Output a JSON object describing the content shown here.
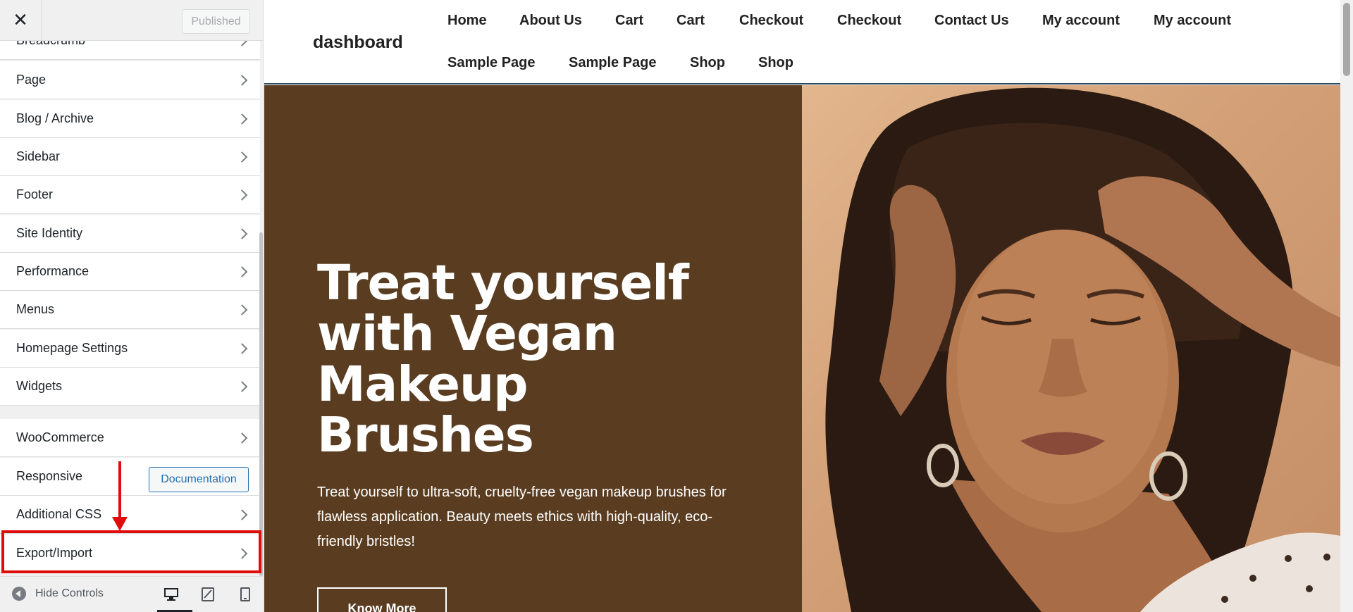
{
  "customizer": {
    "close_icon": "close-icon",
    "publish_label": "Published",
    "panels": [
      {
        "label": "Breadcrumb"
      },
      {
        "label": "Page"
      },
      {
        "label": "Blog / Archive"
      },
      {
        "label": "Sidebar"
      },
      {
        "label": "Footer"
      },
      {
        "label": "Site Identity"
      },
      {
        "label": "Performance"
      },
      {
        "label": "Menus"
      },
      {
        "label": "Homepage Settings"
      },
      {
        "label": "Widgets"
      },
      {
        "label": "WooCommerce"
      },
      {
        "label": "Responsive"
      },
      {
        "label": "Additional CSS"
      },
      {
        "label": "Export/Import"
      }
    ],
    "documentation_label": "Documentation",
    "hide_controls_label": "Hide Controls",
    "annotation_color": "#e00b0b",
    "devices": [
      "desktop-icon",
      "tablet-icon",
      "mobile-icon"
    ]
  },
  "site": {
    "title": "dashboard",
    "nav": [
      "Home",
      "About Us",
      "Cart",
      "Cart",
      "Checkout",
      "Checkout",
      "Contact Us",
      "My account",
      "My account",
      "Sample Page",
      "Sample Page",
      "Shop",
      "Shop"
    ],
    "hero": {
      "title": "Treat yourself with Vegan Makeup Brushes",
      "text": "Treat yourself to ultra-soft, cruelty-free vegan makeup brushes for flawless application. Beauty meets ethics with high-quality, eco-friendly bristles!",
      "button_label": "Know More",
      "bg_color": "#5a3d21"
    }
  }
}
